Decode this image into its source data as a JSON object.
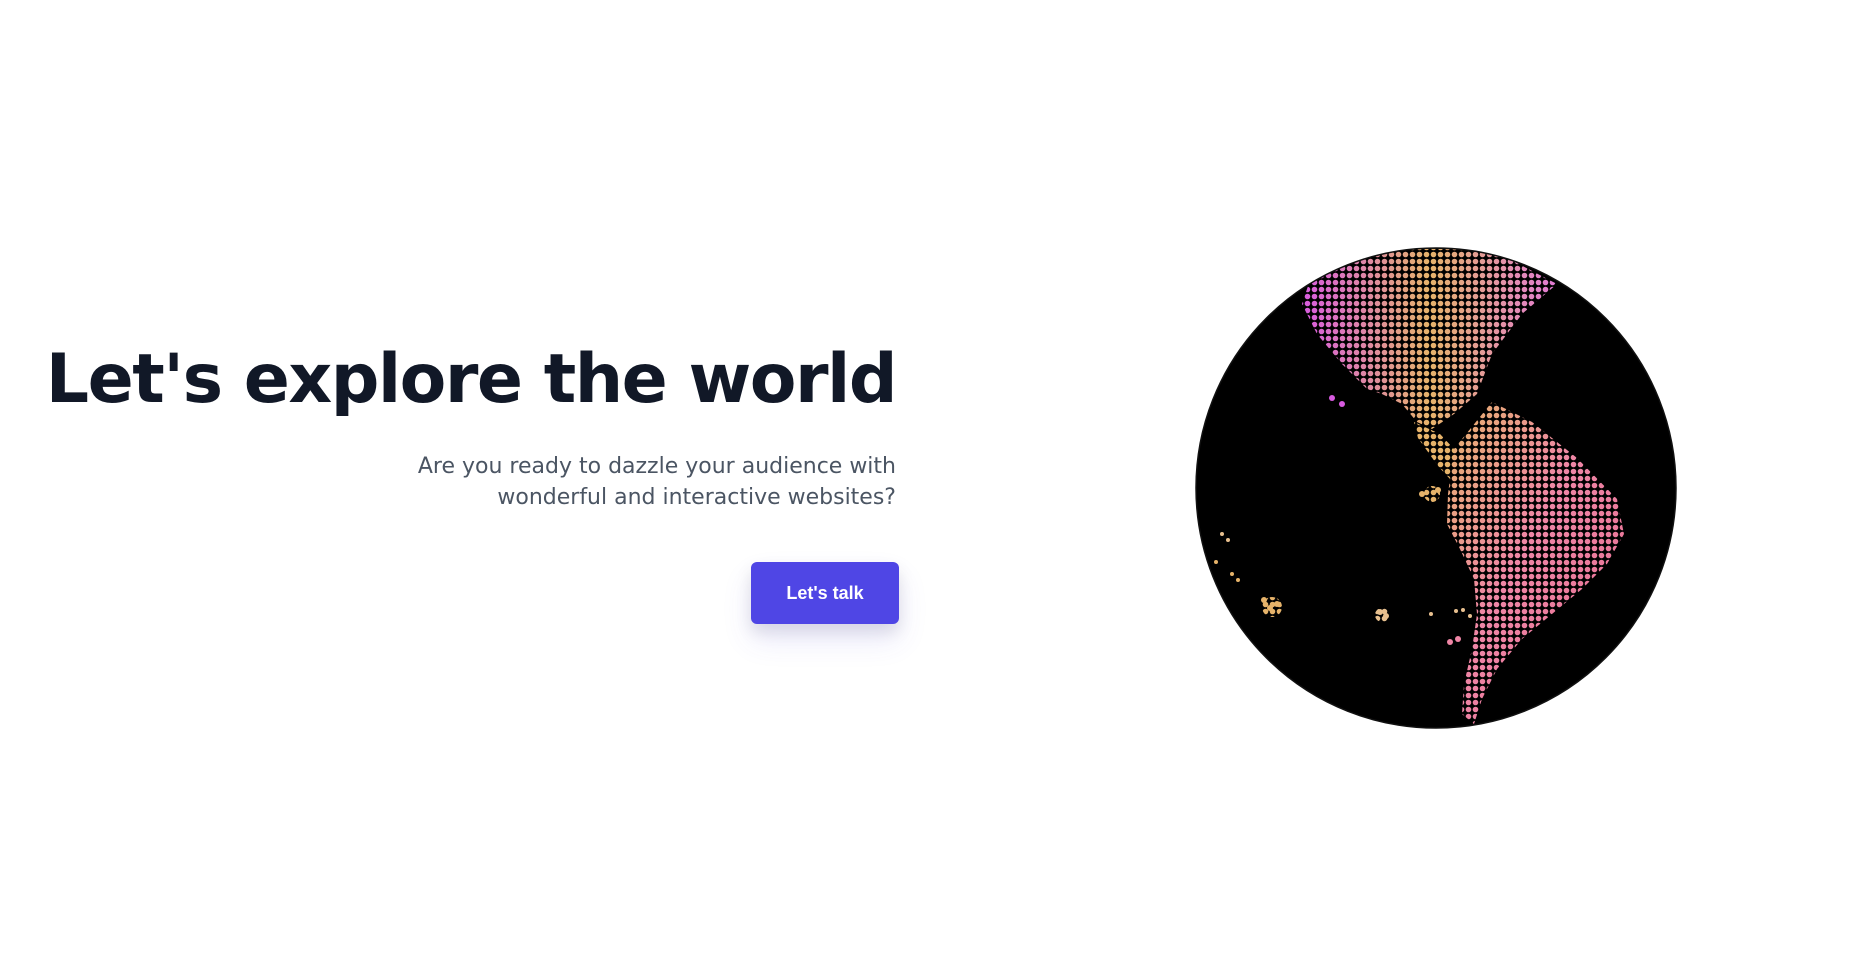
{
  "hero": {
    "headline": "Let's explore the world",
    "subtitle": "Are you ready to dazzle your audience with wonderful and interactive websites?",
    "cta_label": "Let's talk"
  },
  "globe": {
    "icon": "dotted-globe-americas",
    "colors": {
      "ocean": "#000000",
      "land_warm": "#e6b36a",
      "land_magenta": "#d85be0",
      "land_pink": "#ef7aa8",
      "accent": "#4f46e5"
    }
  }
}
